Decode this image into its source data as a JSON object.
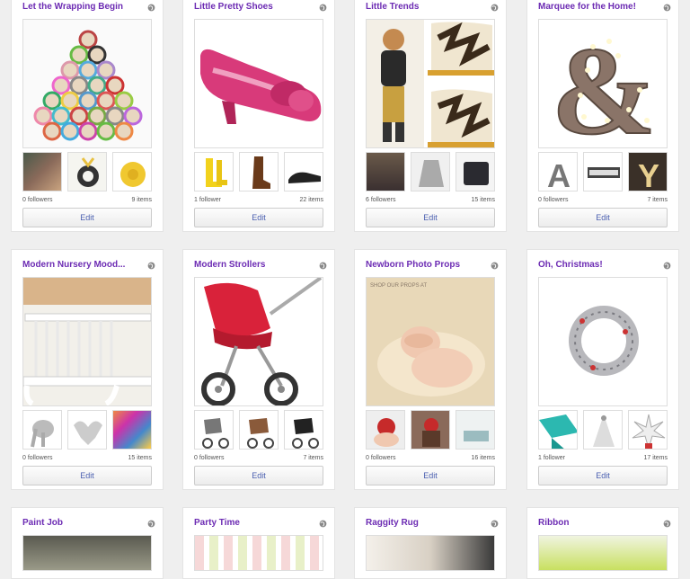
{
  "boards": [
    {
      "title": "Let the Wrapping Begin",
      "followers": "0 followers",
      "items": "9 items",
      "edit": "Edit"
    },
    {
      "title": "Little Pretty Shoes",
      "followers": "1 follower",
      "items": "22 items",
      "edit": "Edit"
    },
    {
      "title": "Little Trends",
      "followers": "6 followers",
      "items": "15 items",
      "edit": "Edit"
    },
    {
      "title": "Marquee for the Home!",
      "followers": "0 followers",
      "items": "7 items",
      "edit": "Edit"
    },
    {
      "title": "Modern Nursery Mood...",
      "followers": "0 followers",
      "items": "15 items",
      "edit": "Edit"
    },
    {
      "title": "Modern Strollers",
      "followers": "0 followers",
      "items": "7 items",
      "edit": "Edit"
    },
    {
      "title": "Newborn Photo Props",
      "followers": "0 followers",
      "items": "16 items",
      "edit": "Edit"
    },
    {
      "title": "Oh, Christmas!",
      "followers": "1 follower",
      "items": "17 items",
      "edit": "Edit"
    },
    {
      "title": "Paint Job"
    },
    {
      "title": "Party Time"
    },
    {
      "title": "Raggity Rug"
    },
    {
      "title": "Ribbon"
    }
  ],
  "marquee_letters": [
    "A",
    "Y"
  ],
  "cover_watermark": "SHOP OUR PROPS AT",
  "colors": {
    "title": "#6c2bb3",
    "edit_text": "#4a5fb0",
    "background": "#efefef"
  }
}
